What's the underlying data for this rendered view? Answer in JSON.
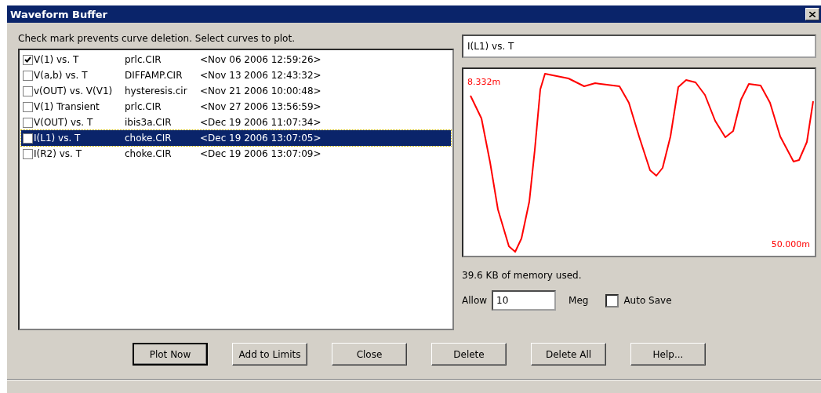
{
  "window": {
    "title": "Waveform Buffer"
  },
  "instructions": "Check mark prevents curve deletion. Select curves to plot.",
  "curves": [
    {
      "name": "V(1) vs. T",
      "file": "prlc.CIR",
      "date": "<Nov 06 2006 12:59:26>",
      "checked": true,
      "selected": false
    },
    {
      "name": "V(a,b) vs. T",
      "file": "DIFFAMP.CIR",
      "date": "<Nov 13 2006 12:43:32>",
      "checked": false,
      "selected": false
    },
    {
      "name": "v(OUT) vs. V(V1)",
      "file": "hysteresis.cir",
      "date": "<Nov 21 2006 10:00:48>",
      "checked": false,
      "selected": false
    },
    {
      "name": "V(1) Transient",
      "file": "prlc.CIR",
      "date": "<Nov 27 2006 13:56:59>",
      "checked": false,
      "selected": false
    },
    {
      "name": "V(OUT) vs. T",
      "file": "ibis3a.CIR",
      "date": "<Dec 19 2006 11:07:34>",
      "checked": false,
      "selected": false
    },
    {
      "name": "I(L1) vs. T",
      "file": "choke.CIR",
      "date": "<Dec 19 2006 13:07:05>",
      "checked": false,
      "selected": true
    },
    {
      "name": "I(R2) vs. T",
      "file": "choke.CIR",
      "date": "<Dec 19 2006 13:07:09>",
      "checked": false,
      "selected": false
    }
  ],
  "curve_title": {
    "value": "I(L1) vs. T"
  },
  "plot": {
    "top_label": "8.332m",
    "bottom_label": "50.000m"
  },
  "memory_text": "39.6 KB of memory used.",
  "allow": {
    "label": "Allow",
    "value": "10",
    "unit": "Meg"
  },
  "auto_save": {
    "label": "Auto Save",
    "checked": false
  },
  "buttons": [
    {
      "label": "Plot Now",
      "default": true
    },
    {
      "label": "Add to Limits",
      "default": false
    },
    {
      "label": "Close",
      "default": false
    },
    {
      "label": "Delete",
      "default": false
    },
    {
      "label": "Delete All",
      "default": false
    },
    {
      "label": "Help...",
      "default": false
    }
  ]
}
